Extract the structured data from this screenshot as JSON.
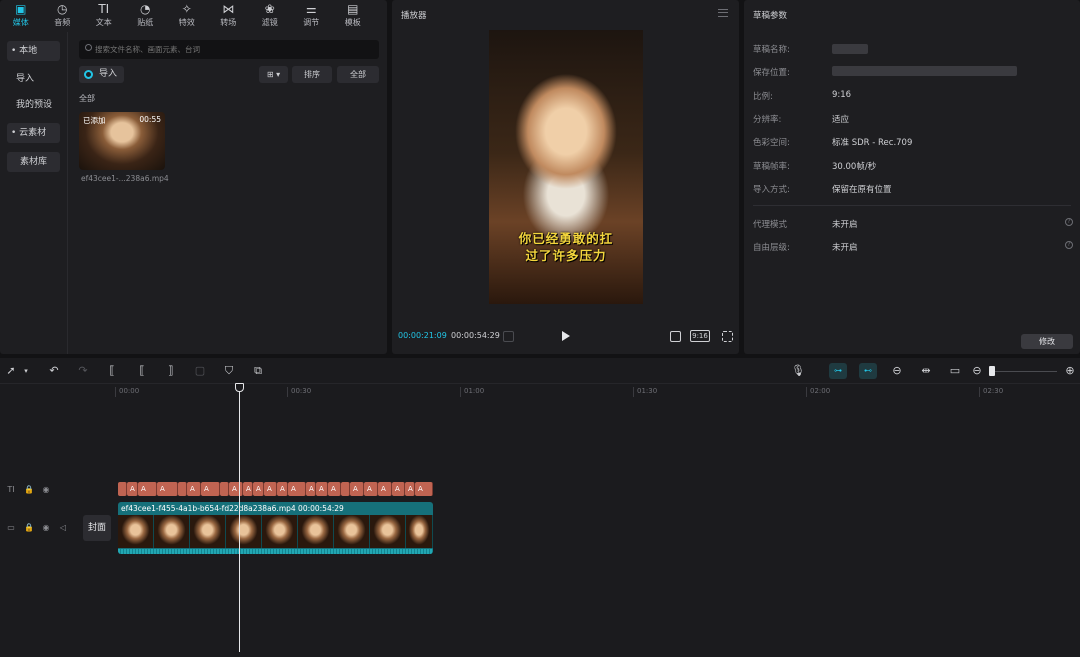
{
  "toolbar": {
    "tabs": [
      {
        "label": "媒体",
        "icon": "media-icon",
        "active": true
      },
      {
        "label": "音频",
        "icon": "audio-icon"
      },
      {
        "label": "文本",
        "icon": "text-icon"
      },
      {
        "label": "贴纸",
        "icon": "sticker-icon"
      },
      {
        "label": "特效",
        "icon": "effects-icon"
      },
      {
        "label": "转场",
        "icon": "transition-icon"
      },
      {
        "label": "滤镜",
        "icon": "filter-icon"
      },
      {
        "label": "调节",
        "icon": "adjust-icon"
      },
      {
        "label": "模板",
        "icon": "template-icon"
      }
    ]
  },
  "sidebar": {
    "items": [
      {
        "label": "• 本地"
      },
      {
        "label": "导入"
      },
      {
        "label": "我的预设"
      },
      {
        "label": "• 云素材"
      },
      {
        "label": "素材库"
      }
    ]
  },
  "media": {
    "search_placeholder": "搜索文件名称、画面元素、台词",
    "import_label": "导入",
    "view_label": "⊞ ▾",
    "sort_label": "排序",
    "filter_label": "全部",
    "section_label": "全部",
    "item": {
      "badge": "已添加",
      "duration": "00:55",
      "name": "ef43cee1-...238a6.mp4"
    }
  },
  "player": {
    "title": "播放器",
    "subtitle_line1": "你已经勇敢的扛",
    "subtitle_line2": "过了许多压力",
    "current_time": "00:00:21:09",
    "total_time": "00:00:54:29",
    "ratio_label": "9:16"
  },
  "draft": {
    "title": "草稿参数",
    "rows": [
      {
        "label": "草稿名称:",
        "value": ""
      },
      {
        "label": "保存位置:",
        "value": ""
      },
      {
        "label": "比例:",
        "value": "9:16"
      },
      {
        "label": "分辨率:",
        "value": "适应"
      },
      {
        "label": "色彩空间:",
        "value": "标准 SDR - Rec.709"
      },
      {
        "label": "草稿帧率:",
        "value": "30.00帧/秒"
      },
      {
        "label": "导入方式:",
        "value": "保留在原有位置"
      }
    ],
    "extra_rows": [
      {
        "label": "代理模式",
        "value": "未开启"
      },
      {
        "label": "自由层级:",
        "value": "未开启"
      }
    ],
    "modify_label": "修改"
  },
  "timeline": {
    "ruler": [
      "00:00",
      "00:30",
      "01:00",
      "01:30",
      "02:00",
      "02:30"
    ],
    "cover_label": "封面",
    "text_clip_label": "A",
    "video_clip_label": "ef43cee1-f455-4a1b-b654-fd22d8a238a6.mp4   00:00:54:29",
    "snap_label_1": "⊶",
    "snap_label_2": "⊷"
  },
  "colors": {
    "accent": "#22c5e6",
    "text_clip": "#c06452",
    "video_clip": "#16707a"
  }
}
